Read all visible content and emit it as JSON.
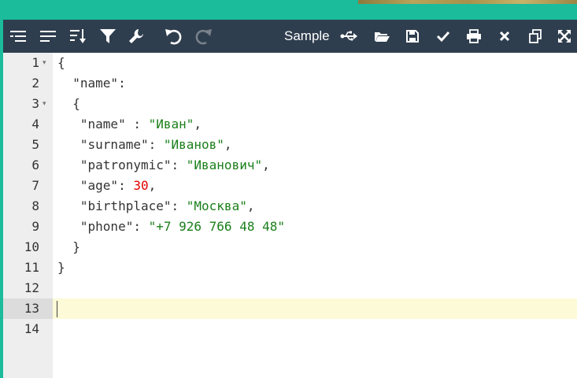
{
  "toolbar": {
    "left_icons": [
      "format-indent-icon",
      "compact-icon",
      "sort-icon",
      "filter-icon",
      "repair-wrench-icon",
      "undo-icon",
      "redo-icon"
    ],
    "sample_label": "Sample",
    "right_icons": [
      "usb-icon",
      "open-folder-icon",
      "save-icon",
      "check-icon",
      "print-icon",
      "close-icon",
      "copy-icon",
      "fullscreen-icon"
    ]
  },
  "editor": {
    "line_numbers": [
      "1",
      "2",
      "3",
      "4",
      "5",
      "6",
      "7",
      "8",
      "9",
      "10",
      "11",
      "12",
      "13",
      "14"
    ],
    "fold_lines": [
      "1",
      "3"
    ],
    "active_line": "13",
    "lines": [
      [
        {
          "t": "punc",
          "v": "{"
        }
      ],
      [
        {
          "t": "key",
          "v": "  \"name\""
        },
        {
          "t": "punc",
          "v": ":"
        }
      ],
      [
        {
          "t": "punc",
          "v": "  {"
        }
      ],
      [
        {
          "t": "key",
          "v": "   \"name\""
        },
        {
          "t": "punc",
          "v": " : "
        },
        {
          "t": "str",
          "v": "\"Иван\""
        },
        {
          "t": "punc",
          "v": ","
        }
      ],
      [
        {
          "t": "key",
          "v": "   \"surname\""
        },
        {
          "t": "punc",
          "v": ": "
        },
        {
          "t": "str",
          "v": "\"Иванов\""
        },
        {
          "t": "punc",
          "v": ","
        }
      ],
      [
        {
          "t": "key",
          "v": "   \"patronymic\""
        },
        {
          "t": "punc",
          "v": ": "
        },
        {
          "t": "str",
          "v": "\"Иванович\""
        },
        {
          "t": "punc",
          "v": ","
        }
      ],
      [
        {
          "t": "key",
          "v": "   \"age\""
        },
        {
          "t": "punc",
          "v": ": "
        },
        {
          "t": "num",
          "v": "30"
        },
        {
          "t": "punc",
          "v": ","
        }
      ],
      [
        {
          "t": "key",
          "v": "   \"birthplace\""
        },
        {
          "t": "punc",
          "v": ": "
        },
        {
          "t": "str",
          "v": "\"Москва\""
        },
        {
          "t": "punc",
          "v": ","
        }
      ],
      [
        {
          "t": "key",
          "v": "   \"phone\""
        },
        {
          "t": "punc",
          "v": ": "
        },
        {
          "t": "str",
          "v": "\"+7 926 766 48 48\""
        }
      ],
      [
        {
          "t": "punc",
          "v": "  }"
        }
      ],
      [
        {
          "t": "punc",
          "v": "}"
        }
      ],
      [],
      [],
      []
    ]
  },
  "colors": {
    "page_background": "#1abc9c",
    "toolbar_background": "#2f3e4e",
    "string": "#1a7f1a",
    "number": "#e00000",
    "active_line": "#fdfbd7"
  }
}
